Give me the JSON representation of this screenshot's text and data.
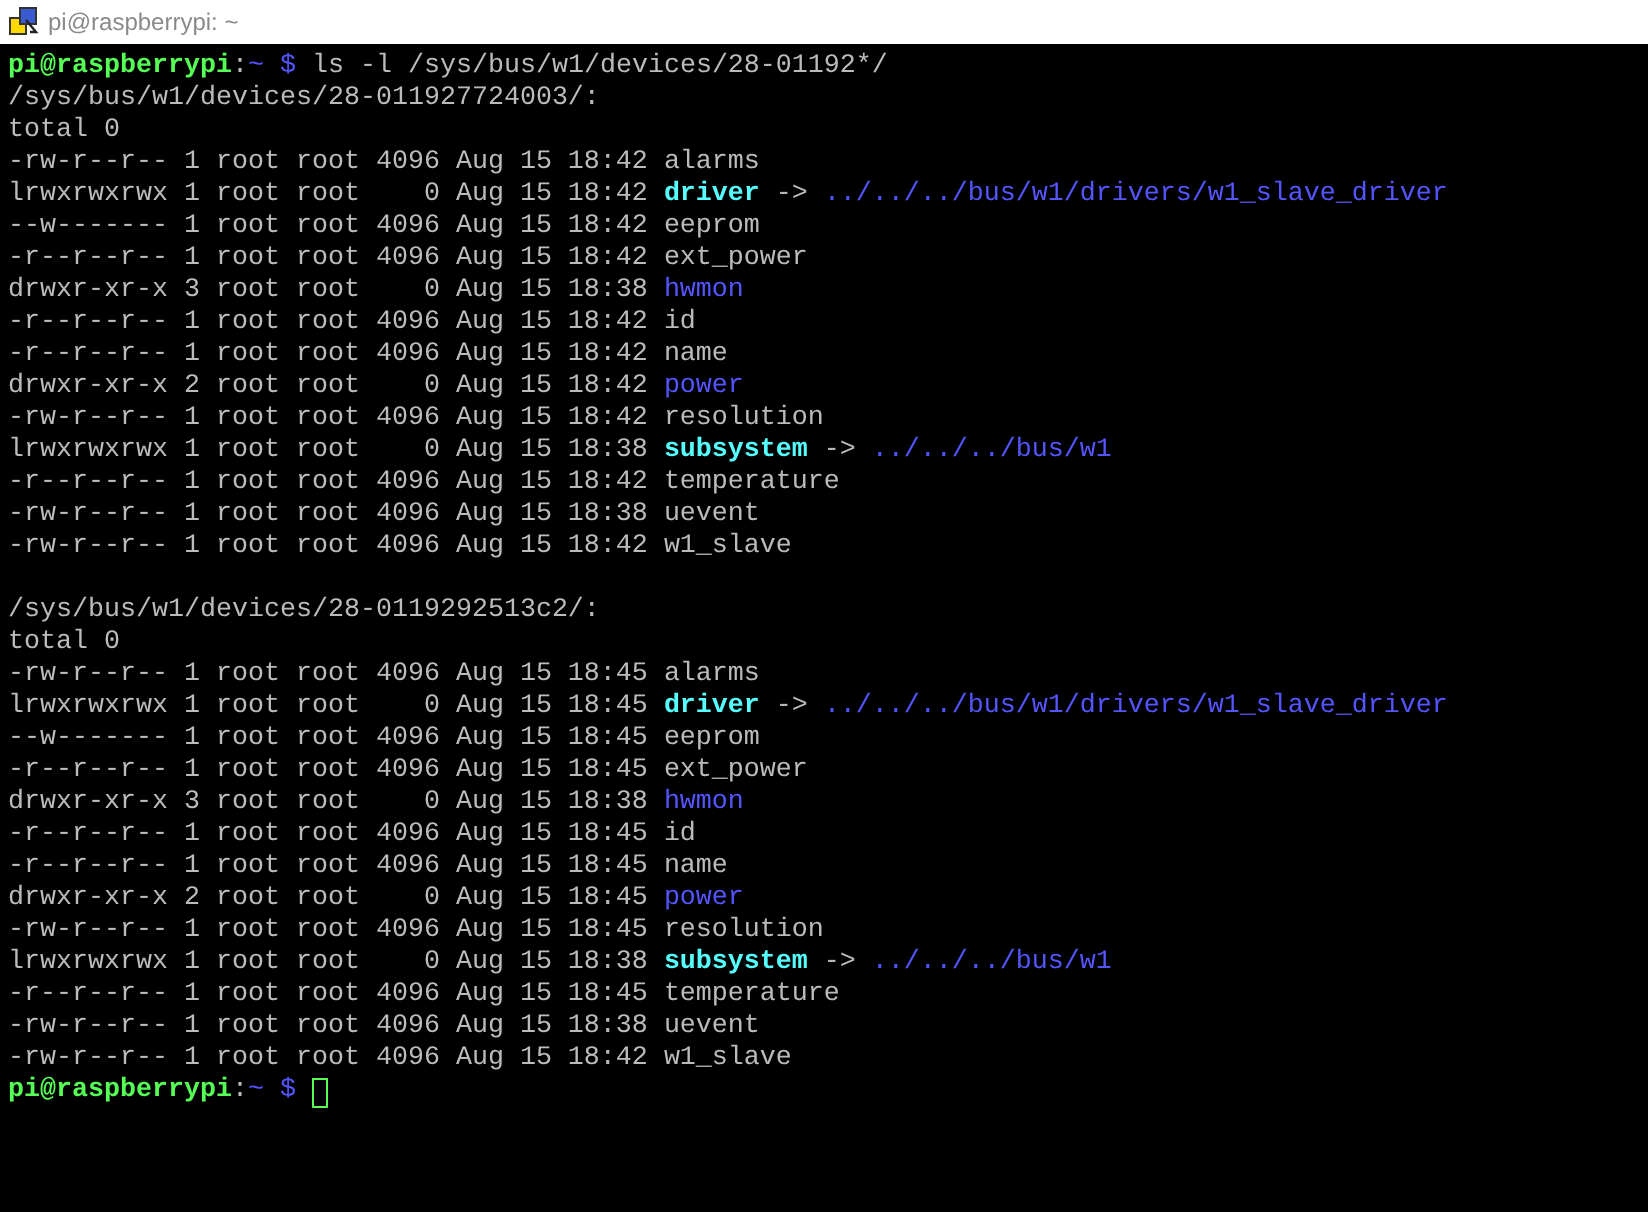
{
  "window": {
    "title": "pi@raspberrypi: ~"
  },
  "prompt": {
    "user_host": "pi@raspberrypi",
    "separator": ":",
    "cwd": "~",
    "symbol": "$",
    "command": "ls -l /sys/bus/w1/devices/28-01192*/"
  },
  "blocks": [
    {
      "header": "/sys/bus/w1/devices/28-011927724003/:",
      "total": "total 0",
      "entries": [
        {
          "meta": "-rw-r--r-- 1 root root 4096 Aug 15 18:42",
          "name": "alarms",
          "kind": "file"
        },
        {
          "meta": "lrwxrwxrwx 1 root root    0 Aug 15 18:42",
          "name": "driver",
          "kind": "link",
          "arrow": "->",
          "target": "../../../bus/w1/drivers/w1_slave_driver"
        },
        {
          "meta": "--w------- 1 root root 4096 Aug 15 18:42",
          "name": "eeprom",
          "kind": "file"
        },
        {
          "meta": "-r--r--r-- 1 root root 4096 Aug 15 18:42",
          "name": "ext_power",
          "kind": "file"
        },
        {
          "meta": "drwxr-xr-x 3 root root    0 Aug 15 18:38",
          "name": "hwmon",
          "kind": "dir"
        },
        {
          "meta": "-r--r--r-- 1 root root 4096 Aug 15 18:42",
          "name": "id",
          "kind": "file"
        },
        {
          "meta": "-r--r--r-- 1 root root 4096 Aug 15 18:42",
          "name": "name",
          "kind": "file"
        },
        {
          "meta": "drwxr-xr-x 2 root root    0 Aug 15 18:42",
          "name": "power",
          "kind": "dir"
        },
        {
          "meta": "-rw-r--r-- 1 root root 4096 Aug 15 18:42",
          "name": "resolution",
          "kind": "file"
        },
        {
          "meta": "lrwxrwxrwx 1 root root    0 Aug 15 18:38",
          "name": "subsystem",
          "kind": "link",
          "arrow": "->",
          "target": "../../../bus/w1"
        },
        {
          "meta": "-r--r--r-- 1 root root 4096 Aug 15 18:42",
          "name": "temperature",
          "kind": "file"
        },
        {
          "meta": "-rw-r--r-- 1 root root 4096 Aug 15 18:38",
          "name": "uevent",
          "kind": "file"
        },
        {
          "meta": "-rw-r--r-- 1 root root 4096 Aug 15 18:42",
          "name": "w1_slave",
          "kind": "file"
        }
      ]
    },
    {
      "header": "/sys/bus/w1/devices/28-0119292513c2/:",
      "total": "total 0",
      "entries": [
        {
          "meta": "-rw-r--r-- 1 root root 4096 Aug 15 18:45",
          "name": "alarms",
          "kind": "file"
        },
        {
          "meta": "lrwxrwxrwx 1 root root    0 Aug 15 18:45",
          "name": "driver",
          "kind": "link",
          "arrow": "->",
          "target": "../../../bus/w1/drivers/w1_slave_driver"
        },
        {
          "meta": "--w------- 1 root root 4096 Aug 15 18:45",
          "name": "eeprom",
          "kind": "file"
        },
        {
          "meta": "-r--r--r-- 1 root root 4096 Aug 15 18:45",
          "name": "ext_power",
          "kind": "file"
        },
        {
          "meta": "drwxr-xr-x 3 root root    0 Aug 15 18:38",
          "name": "hwmon",
          "kind": "dir"
        },
        {
          "meta": "-r--r--r-- 1 root root 4096 Aug 15 18:45",
          "name": "id",
          "kind": "file"
        },
        {
          "meta": "-r--r--r-- 1 root root 4096 Aug 15 18:45",
          "name": "name",
          "kind": "file"
        },
        {
          "meta": "drwxr-xr-x 2 root root    0 Aug 15 18:45",
          "name": "power",
          "kind": "dir"
        },
        {
          "meta": "-rw-r--r-- 1 root root 4096 Aug 15 18:45",
          "name": "resolution",
          "kind": "file"
        },
        {
          "meta": "lrwxrwxrwx 1 root root    0 Aug 15 18:38",
          "name": "subsystem",
          "kind": "link",
          "arrow": "->",
          "target": "../../../bus/w1"
        },
        {
          "meta": "-r--r--r-- 1 root root 4096 Aug 15 18:45",
          "name": "temperature",
          "kind": "file"
        },
        {
          "meta": "-rw-r--r-- 1 root root 4096 Aug 15 18:38",
          "name": "uevent",
          "kind": "file"
        },
        {
          "meta": "-rw-r--r-- 1 root root 4096 Aug 15 18:42",
          "name": "w1_slave",
          "kind": "file"
        }
      ]
    }
  ],
  "final_prompt": {
    "user_host": "pi@raspberrypi",
    "separator": ":",
    "cwd": "~",
    "symbol": "$"
  }
}
